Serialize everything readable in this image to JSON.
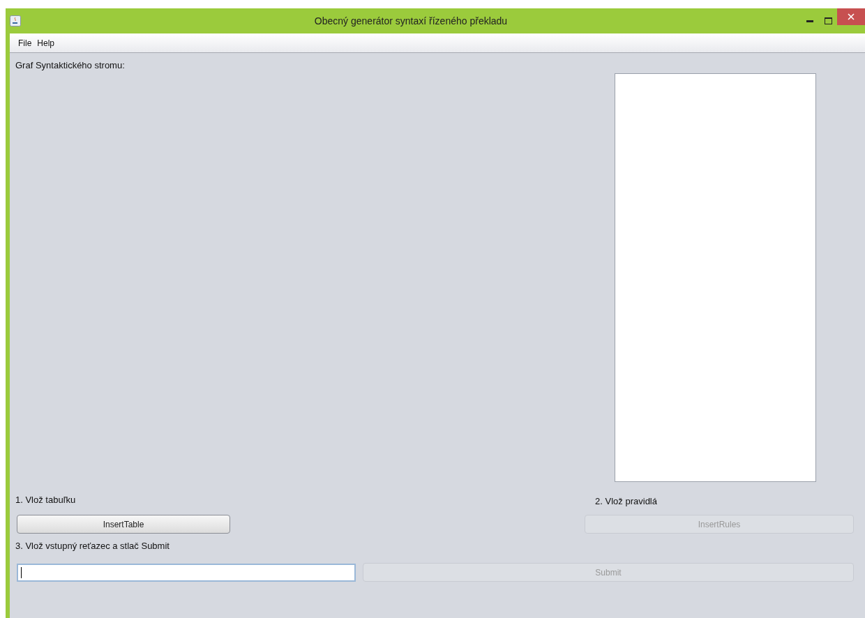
{
  "window": {
    "title": "Obecný generátor syntaxí řízeného překladu"
  },
  "menu": [
    {
      "label": "File"
    },
    {
      "label": "Help"
    }
  ],
  "tree_label": "Graf Syntaktického stromu:",
  "step_table": {
    "label": "1. Vlož tabuľku",
    "button": {
      "label": "InsertTable",
      "disabled": false
    }
  },
  "step_rules": {
    "label": "2. Vlož pravidlá",
    "button": {
      "label": "InsertRules",
      "disabled": true
    }
  },
  "step_input": {
    "label": "3. Vlož vstupný reťazec a stlač Submit",
    "focused": true,
    "button": {
      "label": "Submit",
      "disabled": true
    }
  }
}
